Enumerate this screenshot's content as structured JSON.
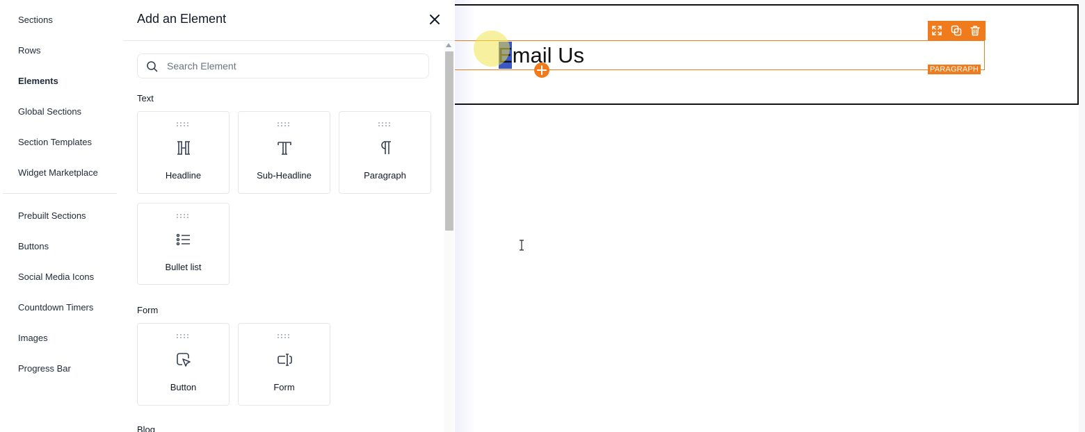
{
  "left_nav": {
    "items": [
      {
        "label": "Sections"
      },
      {
        "label": "Rows"
      },
      {
        "label": "Elements"
      },
      {
        "label": "Global Sections"
      },
      {
        "label": "Section Templates"
      },
      {
        "label": "Widget Marketplace"
      },
      {
        "label": "Prebuilt Sections"
      },
      {
        "label": "Buttons"
      },
      {
        "label": "Social Media Icons"
      },
      {
        "label": "Countdown Timers"
      },
      {
        "label": "Images"
      },
      {
        "label": "Progress Bar"
      }
    ],
    "active": "Elements"
  },
  "panel": {
    "title": "Add an Element",
    "search_placeholder": "Search Element",
    "search_value": "",
    "groups": [
      {
        "label": "Text",
        "elements": [
          {
            "label": "Headline",
            "icon": "headline-icon"
          },
          {
            "label": "Sub-Headline",
            "icon": "sub-headline-icon"
          },
          {
            "label": "Paragraph",
            "icon": "paragraph-icon"
          },
          {
            "label": "Bullet list",
            "icon": "bullet-list-icon"
          }
        ]
      },
      {
        "label": "Form",
        "elements": [
          {
            "label": "Button",
            "icon": "button-cursor-icon"
          },
          {
            "label": "Form",
            "icon": "form-input-icon"
          }
        ]
      },
      {
        "label": "Blog",
        "elements": []
      }
    ]
  },
  "canvas": {
    "paragraph_text": "Email Us",
    "element_badge": "PARAGRAPH",
    "toolbar_icons": [
      "expand-icon",
      "duplicate-icon",
      "trash-icon"
    ],
    "accent_color": "#f07b1c",
    "selection_color": "#3b57c4"
  }
}
